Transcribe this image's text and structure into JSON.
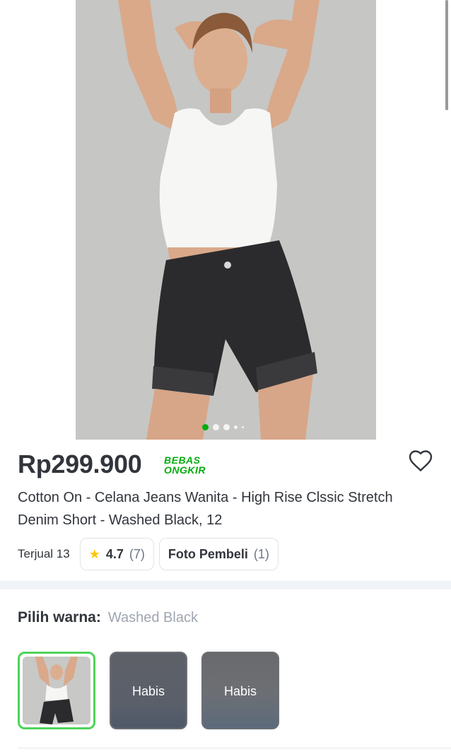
{
  "product": {
    "price": "Rp299.900",
    "free_shipping_line1": "BEBAS",
    "free_shipping_line2": "ONGKIR",
    "title": "Cotton On - Celana Jeans Wanita - High Rise Clssic Stretch Denim Short - Washed Black, 12",
    "sold": "Terjual 13",
    "rating": "4.7",
    "rating_count": "(7)",
    "photo_label": "Foto Pembeli",
    "photo_count": "(1)"
  },
  "gallery": {
    "total_dots": 5,
    "active_index": 0
  },
  "variant": {
    "label": "Pilih warna:",
    "selected": "Washed Black",
    "options": [
      {
        "status": ""
      },
      {
        "status": "Habis"
      },
      {
        "status": "Habis"
      }
    ]
  },
  "colors": {
    "accent": "#03ac0e",
    "text": "#31353b",
    "muted": "#6d7588"
  }
}
